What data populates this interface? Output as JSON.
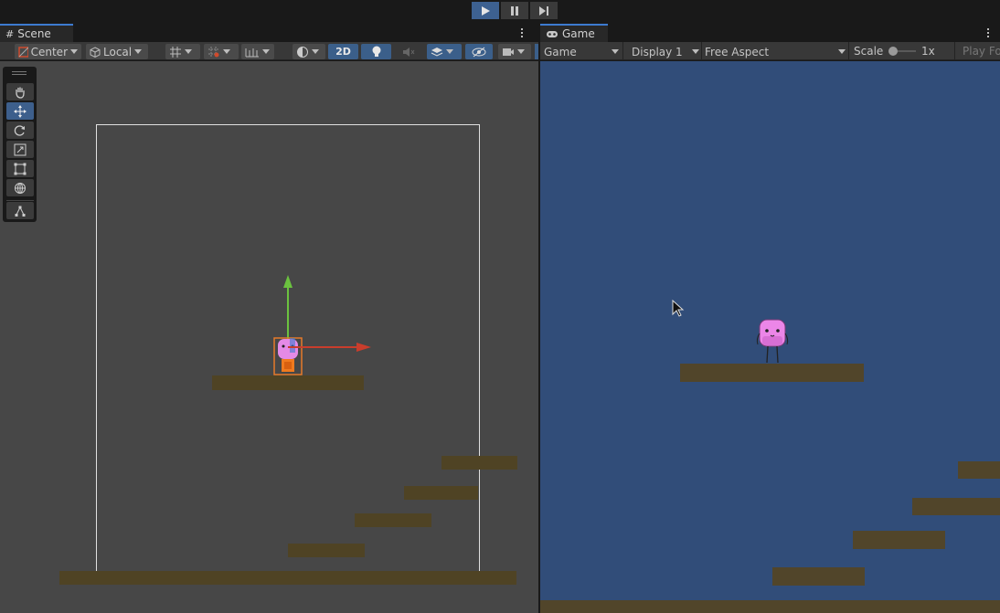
{
  "playbar": {
    "play_icon": "play-icon",
    "pause_icon": "pause-icon",
    "step_icon": "step-icon"
  },
  "scene_panel": {
    "tab_label": "Scene",
    "tab_icon": "grid-icon",
    "toolbar": {
      "pivot_label": "Center",
      "space_label": "Local",
      "mode_2d_label": "2D"
    }
  },
  "game_panel": {
    "tab_label": "Game",
    "tab_icon": "gamepad-icon",
    "toolbar": {
      "view_label": "Game",
      "display_label": "Display 1",
      "aspect_label": "Free Aspect",
      "scale_label": "Scale",
      "scale_value": "1x",
      "play_focused_label": "Play Fo"
    }
  },
  "tools": [
    "hand-tool",
    "move-tool",
    "rotate-tool",
    "scale-tool",
    "rect-tool",
    "transform-tool",
    "custom-tool"
  ],
  "colors": {
    "scene_bg": "#474747",
    "game_bg": "#314d79",
    "platform": "#4f4324",
    "accent": "#3d6191"
  }
}
